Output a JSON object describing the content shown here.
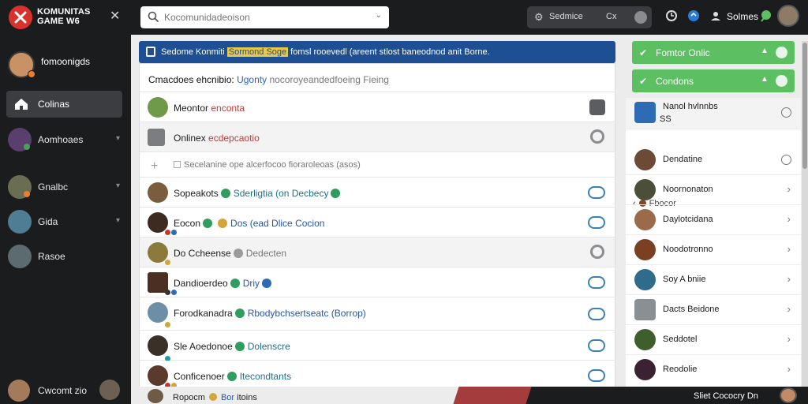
{
  "app": {
    "logo_line1": "KOMUNITAS",
    "logo_line2": "GAME W6"
  },
  "header": {
    "search_placeholder": "Kocomunidadeoison",
    "status_label_1": "Sedmice",
    "status_label_2": "Cx",
    "user_name": "Solmes"
  },
  "sidebar": {
    "profile_name": "fomoonigds",
    "items": [
      {
        "label": "Colinas",
        "active": true,
        "icon": "home-icon"
      },
      {
        "label": "Aomhoaes"
      },
      {
        "label": "Gnalbc"
      },
      {
        "label": "Gida"
      },
      {
        "label": "Rasoe"
      }
    ],
    "bottom_label": "Cwcomt zio"
  },
  "main": {
    "banner_text": "Sedome Konmiti",
    "banner_highlight": "Sormond Soge",
    "banner_rest": "fomsl rooevedl (areent stlost baneodnod anit Borne.",
    "card_header_a": "Cmacdoes ehcnibio:",
    "card_header_b": "Ugonty",
    "card_header_c": "nocoroyeandedfoeing Fieing",
    "rows": [
      {
        "name": "Meontor",
        "sub": "enconta",
        "sub_style": "red",
        "action": "dark"
      },
      {
        "name": "Onlinex",
        "sub": "ecdepcaotio",
        "sub_style": "red",
        "action": "ring"
      },
      {
        "name": "Secelanine ope alcerfocoo fioraroleoas (asos)",
        "action": "none"
      },
      {
        "name": "Sopeakots",
        "sub": "Sderligtia (on Decbecy",
        "sub_style": "teal",
        "action": "pill"
      },
      {
        "name": "Eocon",
        "sub": "Dos (ead Dlice Cocion",
        "sub_style": "blue",
        "action": "pill"
      },
      {
        "name": "Do Ccheense",
        "sub": "Dedecten",
        "sub_style": "gray",
        "action": "ring"
      },
      {
        "name": "Dandioerdeo",
        "sub": "Driy",
        "sub_style": "blue",
        "action": "pill"
      },
      {
        "name": "Forodkanadra",
        "sub": "Rbodybchsertseatc (Borrop)",
        "sub_style": "blue",
        "action": "pill"
      },
      {
        "name": "Sle Aoedonoe",
        "sub": "Dolenscre",
        "sub_style": "teal",
        "action": "pill"
      },
      {
        "name": "Conficenoer",
        "sub": "Itecondtants",
        "sub_style": "teal",
        "action": "pill"
      }
    ]
  },
  "right": {
    "bar1": "Fomtor Onlic",
    "bar2": "Condons",
    "section_label": "Fbocor",
    "items": [
      {
        "name": "Nanol hvlnnbs",
        "sub": "SS",
        "control": "radio"
      },
      {
        "name": "Dendatine",
        "control": "radio"
      },
      {
        "name": "Noornonaton",
        "control": "arrow"
      },
      {
        "name": "Daylotcidana",
        "control": "arrow"
      },
      {
        "name": "Noodotronno",
        "control": "arrow"
      },
      {
        "name": "Soy A bniie",
        "control": "arrow"
      },
      {
        "name": "Dacts Beidone",
        "control": "arrow"
      },
      {
        "name": "Seddotel",
        "control": "arrow"
      },
      {
        "name": "Reodolie",
        "control": "arrow"
      }
    ]
  },
  "bottom": {
    "left_name": "Ropocm",
    "left_sub": "Bor",
    "left_extra": "itoins",
    "right_text": "Sliet Cococry",
    "right_num": "Dn"
  },
  "colors": {
    "accent_blue": "#1f4f93",
    "accent_green": "#5cbf61",
    "dark_bg": "#1b1c1e",
    "brand_red": "#d8312e"
  }
}
